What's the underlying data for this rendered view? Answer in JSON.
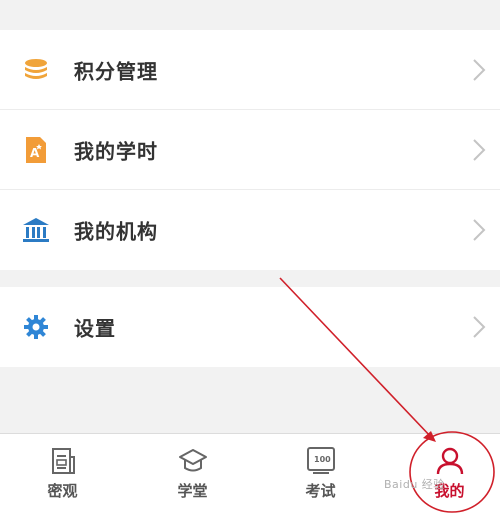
{
  "menu_group_1": {
    "items": [
      {
        "label": "积分管理",
        "icon": "coin-stack-icon"
      },
      {
        "label": "我的学时",
        "icon": "document-a-icon"
      },
      {
        "label": "我的机构",
        "icon": "institution-icon"
      }
    ]
  },
  "menu_group_2": {
    "items": [
      {
        "label": "设置",
        "icon": "gear-icon"
      }
    ]
  },
  "tabbar": {
    "tabs": [
      {
        "label": "密观",
        "icon": "news-icon",
        "active": false
      },
      {
        "label": "学堂",
        "icon": "graduation-cap-icon",
        "active": false
      },
      {
        "label": "考试",
        "icon": "exam-100-icon",
        "active": false
      },
      {
        "label": "我的",
        "icon": "person-icon",
        "active": true
      }
    ],
    "exam_icon_text": "100"
  },
  "colors": {
    "accent": "#c8102e",
    "coin_orange": "#f0a43a",
    "doc_orange": "#f29c38",
    "institution_blue": "#2b7bc4",
    "gear_blue": "#2f86d6",
    "annotation_red": "#d0202a"
  }
}
